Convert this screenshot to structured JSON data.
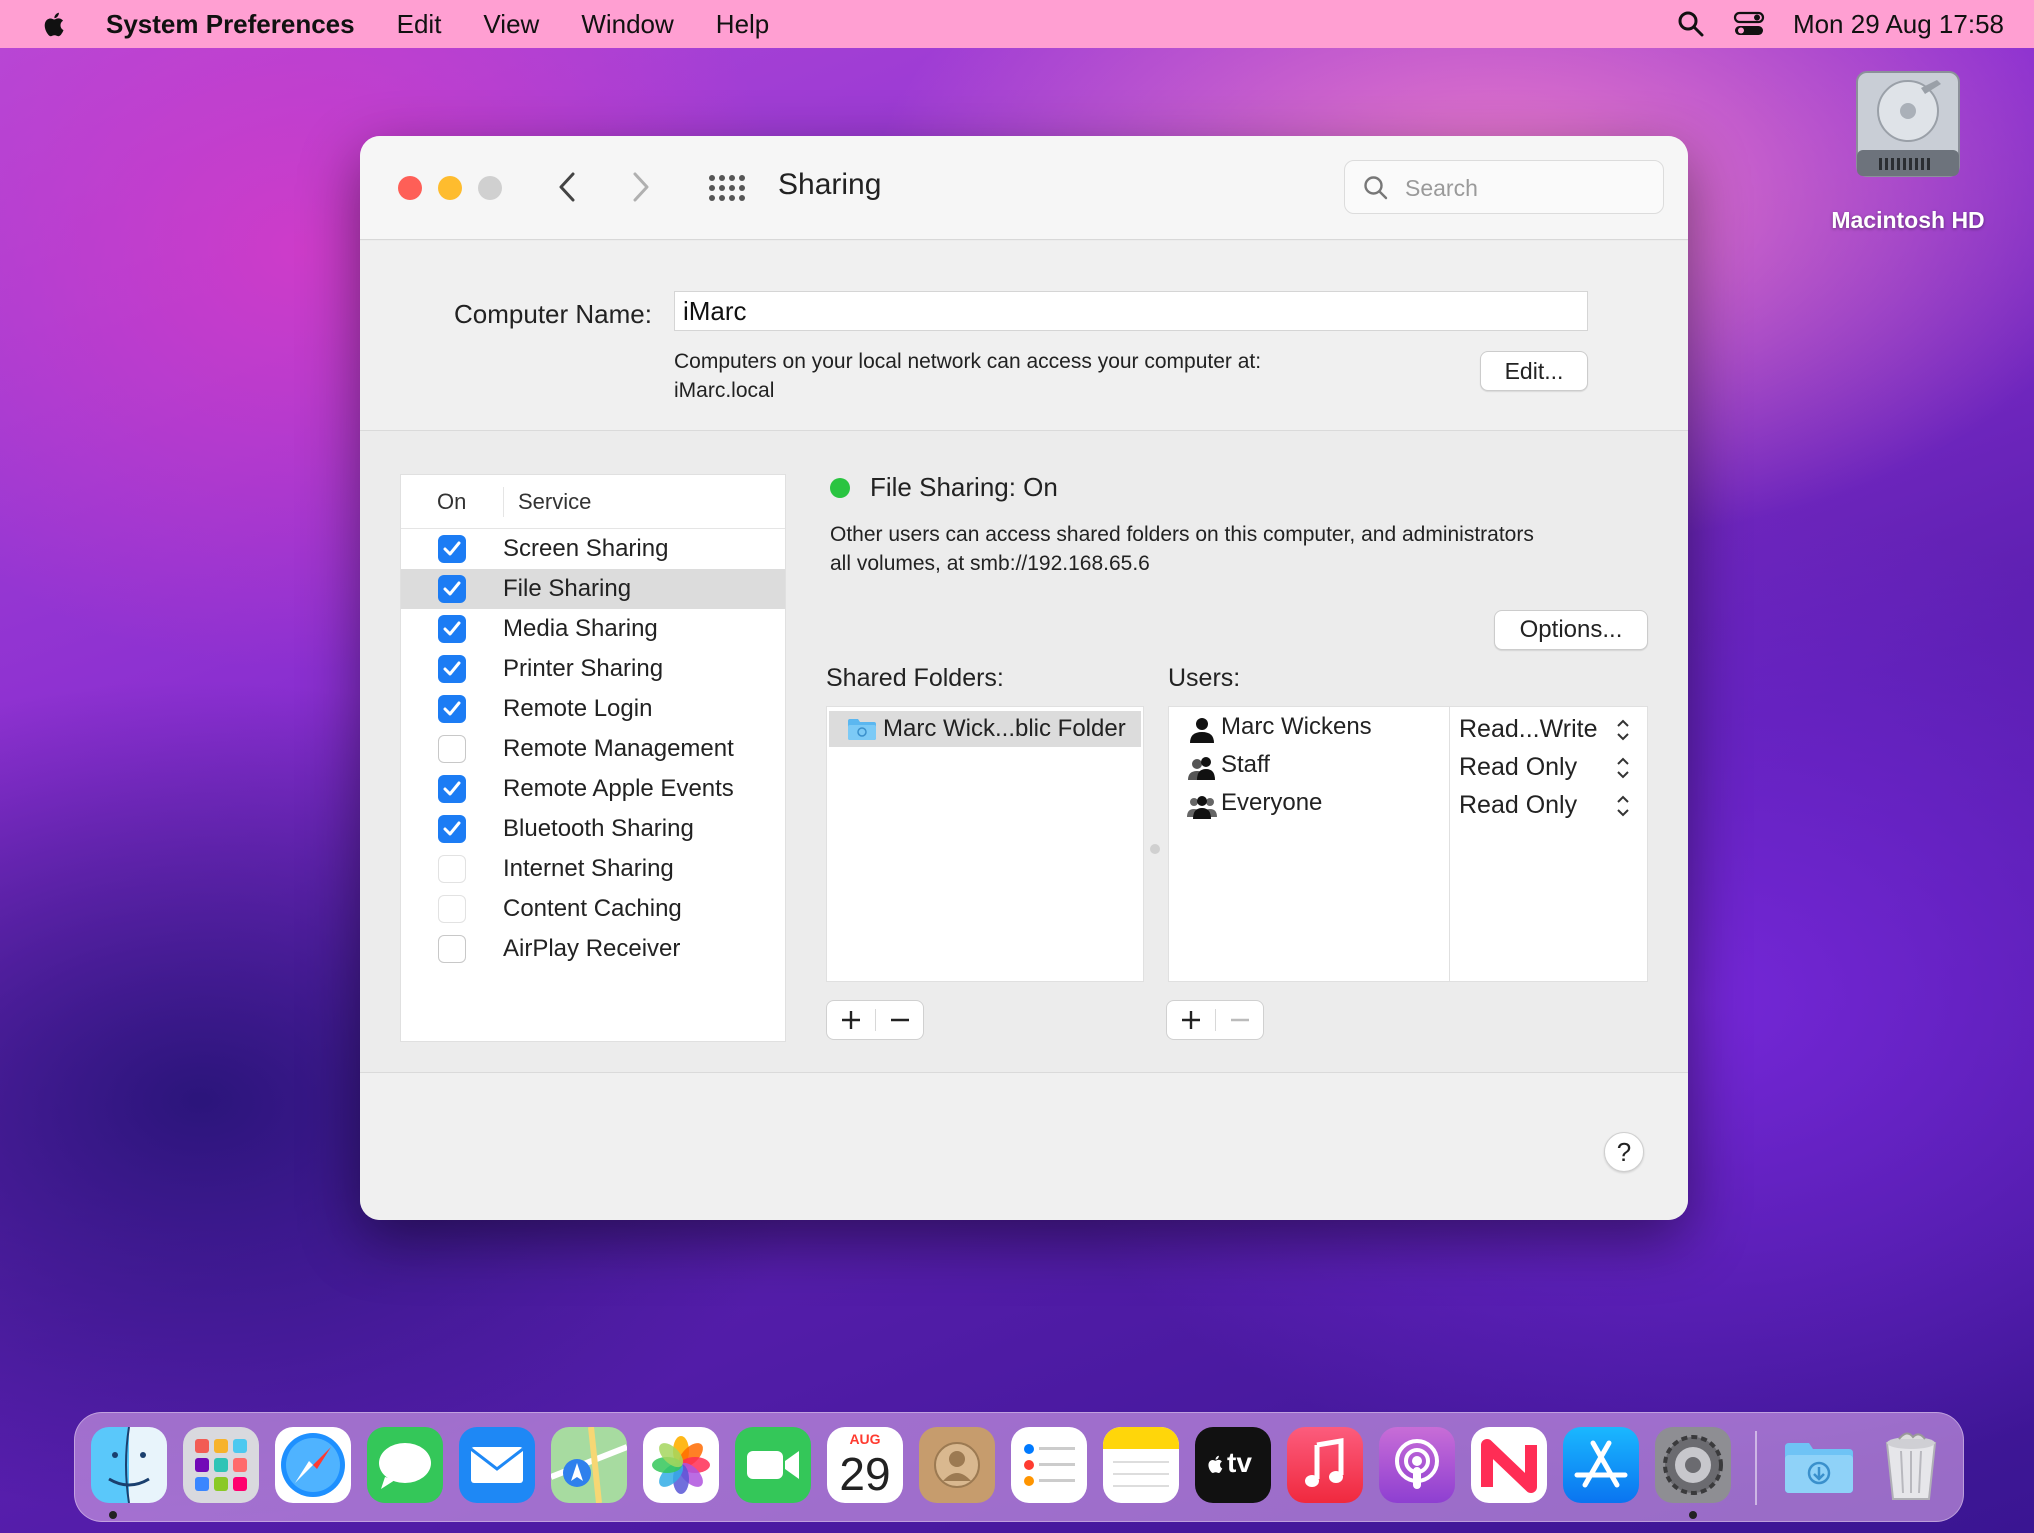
{
  "menubar": {
    "app_name": "System Preferences",
    "items": [
      "Edit",
      "View",
      "Window",
      "Help"
    ],
    "clock": "Mon 29 Aug  17:58"
  },
  "desktop": {
    "drive_label": "Macintosh HD"
  },
  "window": {
    "title": "Sharing",
    "search_placeholder": "Search",
    "computer_name_label": "Computer Name:",
    "computer_name_value": "iMarc",
    "address_line1": "Computers on your local network can access your computer at:",
    "address_line2": "iMarc.local",
    "edit_button": "Edit..."
  },
  "services": {
    "header_on": "On",
    "header_service": "Service",
    "items": [
      {
        "label": "Screen Sharing",
        "checked": true
      },
      {
        "label": "File Sharing",
        "checked": true,
        "selected": true
      },
      {
        "label": "Media Sharing",
        "checked": true
      },
      {
        "label": "Printer Sharing",
        "checked": true
      },
      {
        "label": "Remote Login",
        "checked": true
      },
      {
        "label": "Remote Management",
        "checked": false
      },
      {
        "label": "Remote Apple Events",
        "checked": true
      },
      {
        "label": "Bluetooth Sharing",
        "checked": true
      },
      {
        "label": "Internet Sharing",
        "checked": false
      },
      {
        "label": "Content Caching",
        "checked": false
      },
      {
        "label": "AirPlay Receiver",
        "checked": false
      }
    ]
  },
  "detail": {
    "status": "File Sharing: On",
    "status_color": "#29c440",
    "description_line1": "Other users can access shared folders on this computer, and administrators",
    "description_line2": "all volumes, at smb://192.168.65.6",
    "options_button": "Options...",
    "shared_folders_label": "Shared Folders:",
    "users_label": "Users:",
    "folders": [
      "Marc Wick...blic Folder"
    ],
    "users": [
      {
        "name": "Marc Wickens",
        "icon": "person-icon",
        "permission": "Read...Write"
      },
      {
        "name": "Staff",
        "icon": "group-icon",
        "permission": "Read Only"
      },
      {
        "name": "Everyone",
        "icon": "everyone-icon",
        "permission": "Read Only"
      }
    ],
    "add_symbol": "+",
    "remove_symbol": "−",
    "help_symbol": "?"
  },
  "dock": {
    "month": "AUG",
    "day": "29",
    "tv_label": "tv",
    "apps": [
      "Finder",
      "Launchpad",
      "Safari",
      "Messages",
      "Mail",
      "Maps",
      "Photos",
      "FaceTime",
      "Calendar",
      "Contacts",
      "Reminders",
      "Notes",
      "TV",
      "Music",
      "Podcasts",
      "News",
      "App Store",
      "System Preferences",
      "Downloads",
      "Trash"
    ]
  }
}
